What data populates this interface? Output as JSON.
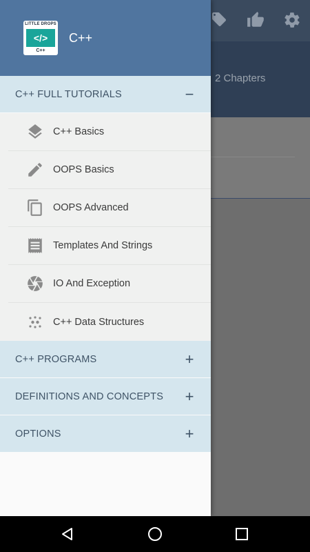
{
  "background": {
    "chapters_text": "2 Chapters"
  },
  "drawer": {
    "app_title": "C++",
    "logo": {
      "top": "LITTLE DROPS",
      "symbol": "</>",
      "bottom": "C++"
    },
    "sections": [
      {
        "label": "C++ FULL TUTORIALS",
        "sign": "−"
      },
      {
        "label": "C++ PROGRAMS",
        "sign": "+"
      },
      {
        "label": "DEFINITIONS AND CONCEPTS",
        "sign": "+"
      },
      {
        "label": "OPTIONS",
        "sign": "+"
      }
    ],
    "items": [
      {
        "label": "C++ Basics",
        "icon": "layers-icon"
      },
      {
        "label": "OOPS Basics",
        "icon": "pencil-icon"
      },
      {
        "label": "OOPS Advanced",
        "icon": "copy-icon"
      },
      {
        "label": "Templates And Strings",
        "icon": "receipt-icon"
      },
      {
        "label": "IO And Exception",
        "icon": "aperture-icon"
      },
      {
        "label": "C++ Data Structures",
        "icon": "dots-icon"
      }
    ]
  },
  "colors": {
    "drawer_header": "#50759f",
    "section_bg": "#d5e6ee",
    "logo_accent": "#1aa59a"
  }
}
